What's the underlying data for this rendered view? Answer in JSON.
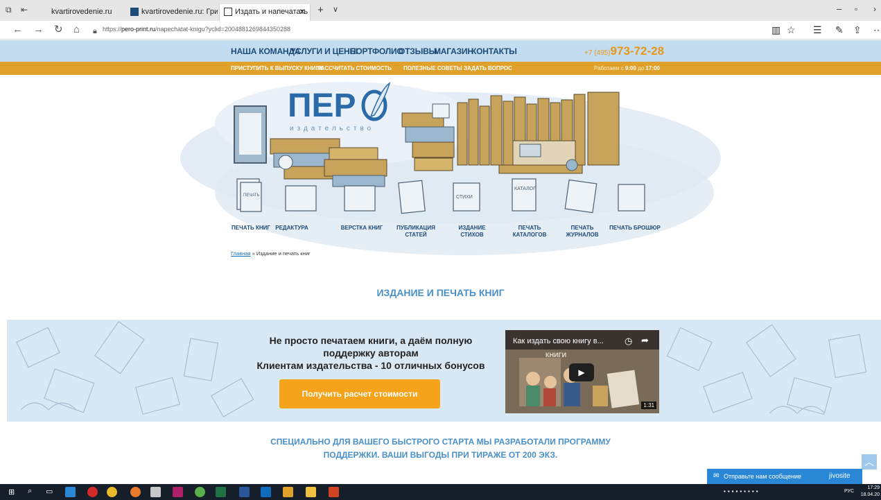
{
  "browser": {
    "tabs": [
      {
        "label": "kvartirovedenie.ru"
      },
      {
        "label": "kvartirovedenie.ru: Григори"
      },
      {
        "label": "Издать и напечатать кı"
      }
    ],
    "url_prefix": "https://",
    "url_domain": "pero-print.ru",
    "url_path": "/napechatat-knigu?yclid=2004881269844350288",
    "icons": [
      "back-icon",
      "forward-icon",
      "refresh-icon",
      "home-icon",
      "lock-icon",
      "reading-view-icon",
      "favorite-star-icon",
      "favorites-hub-icon",
      "pen-icon",
      "share-icon",
      "more-icon"
    ]
  },
  "site": {
    "top_menu": [
      "НАША КОМАНДА",
      "УСЛУГИ И ЦЕНЫ",
      "ПОРТФОЛИО",
      "ОТЗЫВЫ",
      "МАГАЗИН",
      "КОНТАКТЫ"
    ],
    "phone_prefix": "+7 (495)",
    "phone_number": "973-72-28",
    "sub_menu": [
      "ПРИСТУПИТЬ К ВЫПУСКУ КНИГИ",
      "РАССЧИТАТЬ СТОИМОСТЬ",
      "ПОЛЕЗНЫЕ СОВЕТЫ",
      "ЗАДАТЬ ВОПРОС"
    ],
    "hours_prefix": "Работаем с",
    "hours_from": "9:00",
    "hours_mid": "до",
    "hours_to": "17:00",
    "logo_text": "ПЕР",
    "logo_sub": "издательство",
    "services": [
      {
        "line1": "ПЕЧАТЬ КНИГ",
        "line2": ""
      },
      {
        "line1": "РЕДАКТУРА",
        "line2": ""
      },
      {
        "line1": "ВЕРСТКА КНИГ",
        "line2": ""
      },
      {
        "line1": "ПУБЛИКАЦИЯ",
        "line2": "СТАТЕЙ"
      },
      {
        "line1": "ИЗДАНИЕ",
        "line2": "СТИХОВ"
      },
      {
        "line1": "ПЕЧАТЬ",
        "line2": "КАТАЛОГОВ"
      },
      {
        "line1": "ПЕЧАТЬ",
        "line2": "ЖУРНАЛОВ"
      },
      {
        "line1": "ПЕЧАТЬ БРОШЮР",
        "line2": ""
      }
    ],
    "illustration_labels": {
      "print": "ПЕЧАТЬ",
      "verses": "СТИХИ",
      "catalog": "КАТАЛОГ"
    },
    "breadcrumb_home": "Главная",
    "breadcrumb_sep": " » ",
    "breadcrumb_current": "Издание и печать книг",
    "page_title": "ИЗДАНИЕ И ПЕЧАТЬ КНИГ",
    "banner_line1": "Не просто печатаем книги, а даём полную",
    "banner_line2": "поддержку авторам",
    "banner_line3": "Клиентам издательства - 10 отличных бонусов",
    "cta_label": "Получить расчет стоимости",
    "video_title": "Как издать свою книгу в...",
    "video_sign": "КНИГИ",
    "video_duration": "1:31",
    "promo_line1": "СПЕЦИАЛЬНО ДЛЯ ВАШЕГО БЫСТРОГО СТАРТА МЫ РАЗРАБОТАЛИ ПРОГРАММУ",
    "promo_line2": "ПОДДЕРЖКИ. ВАШИ ВЫГОДЫ ПРИ ТИРАЖЕ ОТ 200 ЭКЗ.",
    "chat_label": "Отправьте нам сообщение",
    "chat_brand": "jivosite"
  },
  "taskbar": {
    "lang": "РУС",
    "time": "17:29",
    "date": "18.04.20"
  },
  "colors": {
    "nav_bg": "#c4dcef",
    "orange_bar": "#e0a12a",
    "accent_blue": "#4a90c8",
    "cta_orange": "#f5a31a",
    "chat_blue": "#2a87d6"
  }
}
